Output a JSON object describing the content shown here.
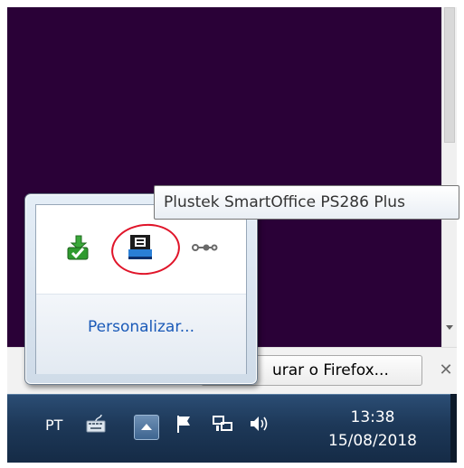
{
  "tooltip": {
    "text": "Plustek SmartOffice PS286 Plus"
  },
  "tray_popup": {
    "icons": [
      "green-upload-check-icon",
      "scanner-icon",
      "usb-connector-icon"
    ],
    "customize_link": "Personalizar..."
  },
  "notification_bar": {
    "button_label": "urar o Firefox...",
    "close_label": "✕"
  },
  "taskbar": {
    "language": "PT",
    "time": "13:38",
    "date": "15/08/2018",
    "icons": [
      "keyboard-icon",
      "show-hidden-icons-icon",
      "action-center-flag-icon",
      "network-icon",
      "volume-icon"
    ]
  },
  "colors": {
    "desktop": "#2a0137",
    "taskbar": "#1d3858",
    "link": "#1a5ab8",
    "annotation": "#e0152a"
  }
}
